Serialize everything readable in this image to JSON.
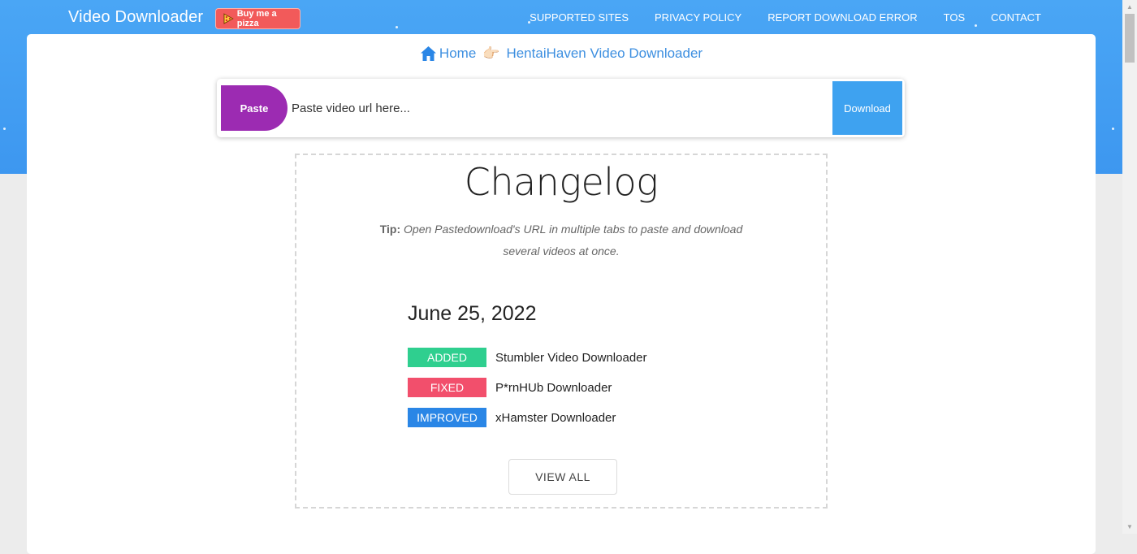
{
  "header": {
    "brand": "Video Downloader",
    "pizza_label": "Buy me a pizza",
    "nav": [
      "SUPPORTED SITES",
      "PRIVACY POLICY",
      "REPORT DOWNLOAD ERROR",
      "TOS",
      "CONTACT"
    ]
  },
  "breadcrumb": {
    "home": "Home",
    "separator_icon": "pointing-hand-icon",
    "current": "HentaiHaven Video Downloader"
  },
  "search": {
    "paste_label": "Paste",
    "placeholder": "Paste video url here...",
    "download_label": "Download"
  },
  "changelog": {
    "title": "Changelog",
    "tip_label": "Tip:",
    "tip_text": "Open Pastedownload's URL in multiple tabs to paste and download several videos at once.",
    "date": "June 25, 2022",
    "entries": [
      {
        "badge": "ADDED",
        "text": "Stumbler Video Downloader",
        "color": "#2fcf8f"
      },
      {
        "badge": "FIXED",
        "text": "P*rnHUb Downloader",
        "color": "#f24f6c"
      },
      {
        "badge": "IMPROVED",
        "text": "xHamster Downloader",
        "color": "#2a86e6"
      }
    ],
    "view_all_label": "VIEW ALL"
  },
  "colors": {
    "hero": "#3d97f0",
    "paste": "#9c2bb2",
    "download": "#3ea2f0",
    "link": "#3d8fe0"
  }
}
